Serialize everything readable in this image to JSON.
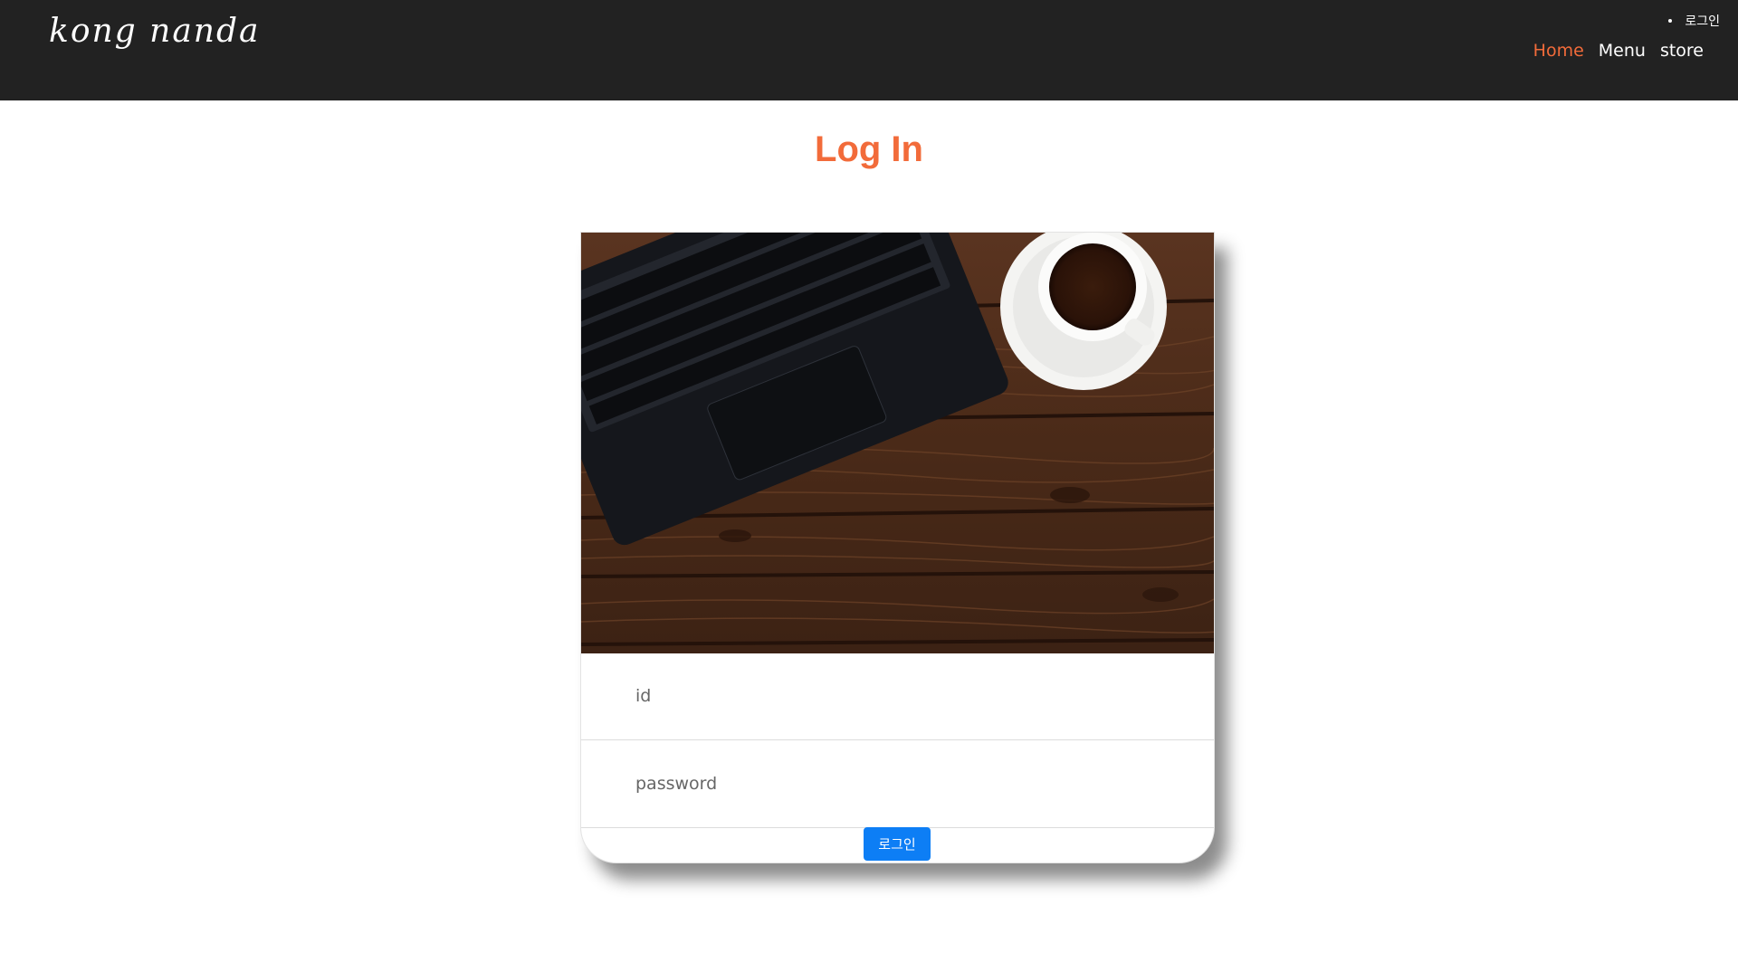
{
  "header": {
    "logo_text": "kong nanda",
    "top_link": "로그인",
    "nav": [
      {
        "label": "Home",
        "active": true
      },
      {
        "label": "Menu",
        "active": false
      },
      {
        "label": "store",
        "active": false
      }
    ]
  },
  "main": {
    "title": "Log In",
    "form": {
      "id_placeholder": "id",
      "password_placeholder": "password",
      "submit_label": "로그인"
    }
  },
  "colors": {
    "header_bg": "#222222",
    "accent": "#f26b3a",
    "button": "#0d7ef5"
  }
}
